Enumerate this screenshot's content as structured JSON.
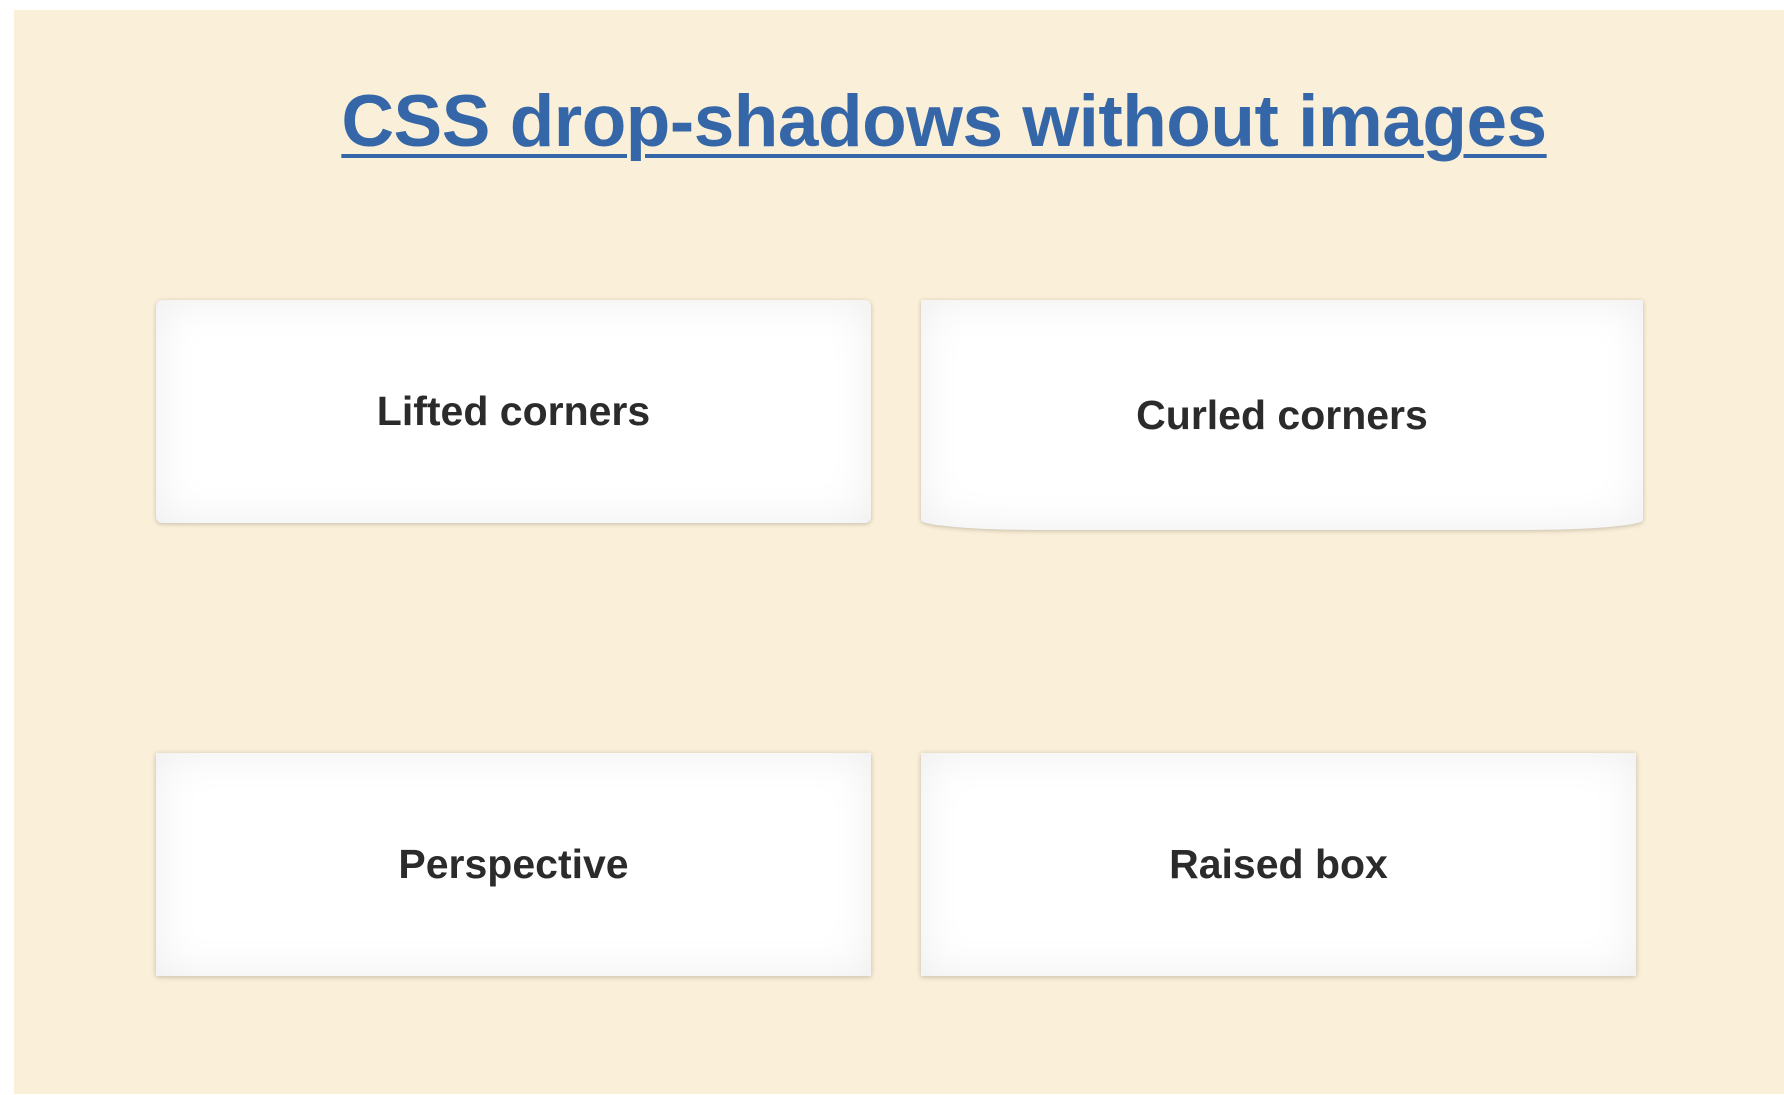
{
  "page": {
    "title": "CSS drop-shadows without images",
    "background_color": "#faefd8",
    "link_color": "#3466a8"
  },
  "boxes": [
    {
      "label": "Lifted corners",
      "effect": "lifted"
    },
    {
      "label": "Curled corners",
      "effect": "curled"
    },
    {
      "label": "Perspective",
      "effect": "perspective"
    },
    {
      "label": "Raised box",
      "effect": "raised"
    }
  ]
}
